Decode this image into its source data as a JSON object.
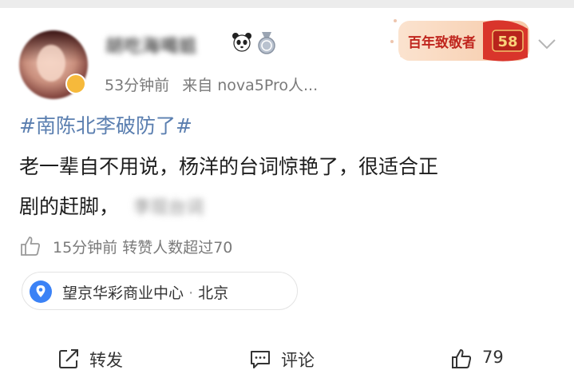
{
  "post": {
    "username": "胡吃海喝姐",
    "time_ago": "53分钟前",
    "source": "来自 nova5Pro人...",
    "topic": "#南陈北李破防了#",
    "text_line1": "老一辈自不用说，杨洋的台词惊艳了，很适合正",
    "text_line2": "剧的赶脚，",
    "text_blurred": "李现台词"
  },
  "promo": {
    "label": "百年致敬者",
    "number": "58"
  },
  "likes_info": "15分钟前 转赞人数超过70",
  "location": {
    "name": "望京华彩商业中心",
    "separator": "·",
    "city": "北京"
  },
  "actions": {
    "repost_label": "转发",
    "comment_label": "评论",
    "like_count": "79"
  },
  "colors": {
    "topic": "#5b7fb0",
    "meta_gray": "#7a7a7a",
    "promo_red": "#d9352b",
    "location_blue": "#3b82f6"
  }
}
